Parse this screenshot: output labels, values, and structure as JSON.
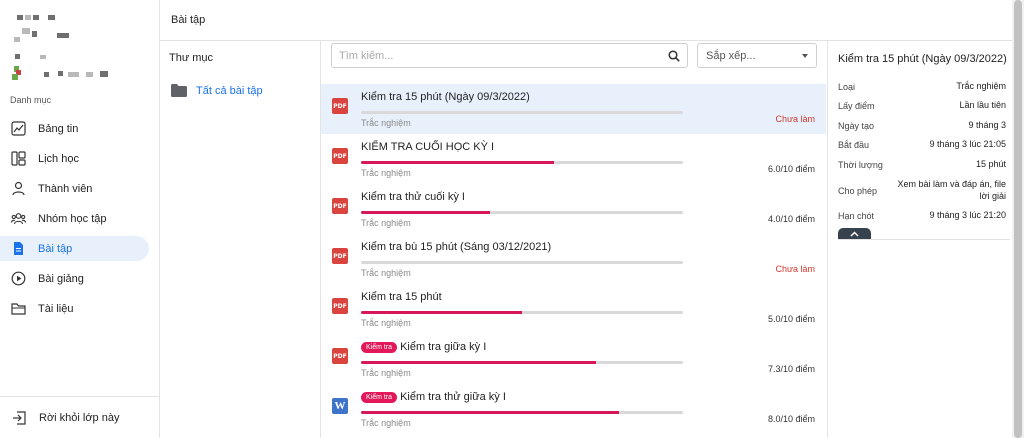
{
  "sidebar": {
    "category_label": "Danh mục",
    "items": [
      {
        "label": "Bảng tin",
        "icon": "trending-chart-icon",
        "active": false
      },
      {
        "label": "Lịch học",
        "icon": "schedule-grid-icon",
        "active": false
      },
      {
        "label": "Thành viên",
        "icon": "user-icon",
        "active": false
      },
      {
        "label": "Nhóm học tập",
        "icon": "group-icon",
        "active": false
      },
      {
        "label": "Bài tập",
        "icon": "document-icon",
        "active": true
      },
      {
        "label": "Bài giảng",
        "icon": "play-circle-icon",
        "active": false
      },
      {
        "label": "Tài liệu",
        "icon": "folder-icon",
        "active": false
      }
    ],
    "leave_label": "Rời khỏi lớp này"
  },
  "header": {
    "title": "Bài tập"
  },
  "folders": {
    "title": "Thư mục",
    "all_label": "Tất cả bài tập"
  },
  "toolbar": {
    "search_placeholder": "Tìm kiếm...",
    "sort_label": "Sắp xếp..."
  },
  "assignments": [
    {
      "title": "Kiểm tra 15 phút (Ngày 09/3/2022)",
      "badge": "",
      "type": "Trắc nghiệm",
      "status": "Chưa làm",
      "pending": true,
      "progress": 0,
      "file": "pdf",
      "selected": true
    },
    {
      "title": "KIỂM TRA CUỐI HỌC KỲ I",
      "badge": "",
      "type": "Trắc nghiệm",
      "status": "6.0/10 điểm",
      "pending": false,
      "progress": 0.6,
      "file": "pdf",
      "selected": false
    },
    {
      "title": "Kiểm tra thử cuối kỳ I",
      "badge": "",
      "type": "Trắc nghiệm",
      "status": "4.0/10 điểm",
      "pending": false,
      "progress": 0.4,
      "file": "pdf",
      "selected": false
    },
    {
      "title": "Kiểm tra bù 15 phút (Sáng 03/12/2021)",
      "badge": "",
      "type": "Trắc nghiệm",
      "status": "Chưa làm",
      "pending": true,
      "progress": 0,
      "file": "pdf",
      "selected": false
    },
    {
      "title": "Kiểm tra 15 phút",
      "badge": "",
      "type": "Trắc nghiệm",
      "status": "5.0/10 điểm",
      "pending": false,
      "progress": 0.5,
      "file": "pdf",
      "selected": false
    },
    {
      "title": "Kiểm tra giữa kỳ I",
      "badge": "Kiểm tra",
      "type": "Trắc nghiệm",
      "status": "7.3/10 điểm",
      "pending": false,
      "progress": 0.73,
      "file": "pdf",
      "selected": false
    },
    {
      "title": "Kiểm tra thử giữa kỳ I",
      "badge": "Kiểm tra",
      "type": "Trắc nghiệm",
      "status": "8.0/10 điểm",
      "pending": false,
      "progress": 0.8,
      "file": "word",
      "selected": false
    }
  ],
  "detail": {
    "title": "Kiểm tra 15 phút (Ngày 09/3/2022)",
    "rows": [
      {
        "key": "Loại",
        "value": "Trắc nghiệm"
      },
      {
        "key": "Lấy điểm",
        "value": "Lần lầu tiên"
      },
      {
        "key": "Ngày tạo",
        "value": "9 tháng 3"
      },
      {
        "key": "Bắt đầu",
        "value": "9 tháng 3 lúc 21:05"
      },
      {
        "key": "Thời lượng",
        "value": "15 phút"
      },
      {
        "key": "Cho phép",
        "value": "Xem bài làm và đáp án, file lời giải"
      },
      {
        "key": "Hạn chót",
        "value": "9 tháng 3 lúc 21:20"
      }
    ]
  },
  "colors": {
    "accent": "#1a73e8",
    "danger": "#d23a2e",
    "progress": "#d6185a",
    "badge": "#e2185b"
  }
}
